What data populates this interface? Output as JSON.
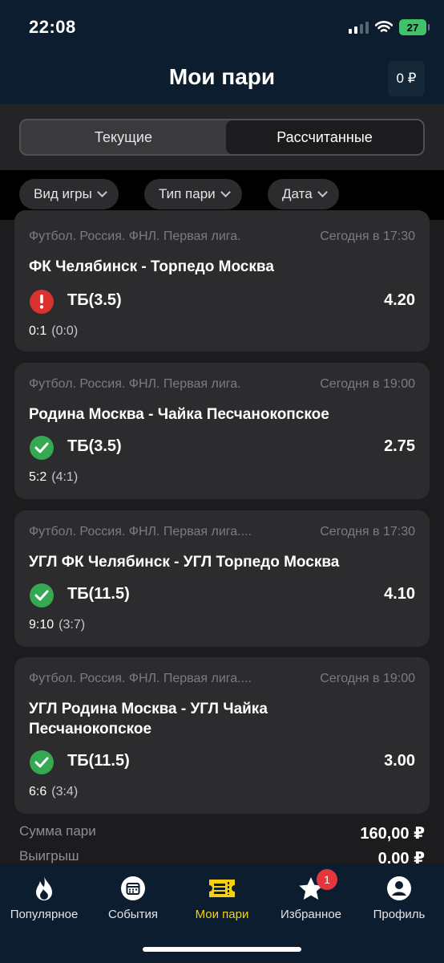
{
  "status_bar": {
    "time": "22:08",
    "battery": "27"
  },
  "header": {
    "title": "Мои пари",
    "balance": "0 ₽"
  },
  "segmented": {
    "current": "Текущие",
    "settled": "Рассчитанные"
  },
  "filters": {
    "game_type": "Вид игры",
    "bet_type": "Тип пари",
    "date": "Дата"
  },
  "bets": [
    {
      "league": "Футбол. Россия. ФНЛ. Первая лига.",
      "time": "Сегодня в 17:30",
      "match": "ФК Челябинск - Торпедо Москва",
      "status": "error",
      "bet": "ТБ(3.5)",
      "odds": "4.20",
      "score": "0:1",
      "half": "(0:0)"
    },
    {
      "league": "Футбол. Россия. ФНЛ. Первая лига.",
      "time": "Сегодня в 19:00",
      "match": "Родина Москва - Чайка Песчанокопское",
      "status": "win",
      "bet": "ТБ(3.5)",
      "odds": "2.75",
      "score": "5:2",
      "half": "(4:1)"
    },
    {
      "league": "Футбол. Россия. ФНЛ. Первая лига....",
      "time": "Сегодня в 17:30",
      "match": "УГЛ ФК Челябинск - УГЛ Торпедо Москва",
      "status": "win",
      "bet": "ТБ(11.5)",
      "odds": "4.10",
      "score": "9:10",
      "half": "(3:7)"
    },
    {
      "league": "Футбол. Россия. ФНЛ. Первая лига....",
      "time": "Сегодня в 19:00",
      "match": "УГЛ Родина Москва - УГЛ Чайка Песчанокопское",
      "status": "win",
      "bet": "ТБ(11.5)",
      "odds": "3.00",
      "score": "6:6",
      "half": "(3:4)"
    }
  ],
  "summary": {
    "stake_label": "Сумма пари",
    "stake_value": "160,00 ₽",
    "win_label": "Выигрыш",
    "win_value": "0.00 ₽"
  },
  "tabbar": {
    "popular": "Популярное",
    "events": "События",
    "my_bets": "Мои пари",
    "favorites": "Избранное",
    "favorites_badge": "1",
    "profile": "Профиль"
  },
  "colors": {
    "accent": "#f6d10d",
    "win": "#35a852",
    "error": "#d9322f",
    "header_bg": "#0b1d2e"
  },
  "icons": [
    "fire-icon",
    "calendar-icon",
    "ticket-icon",
    "star-icon",
    "person-icon",
    "check-icon",
    "exclamation-icon",
    "chevron-down-icon",
    "wifi-icon",
    "signal-icon",
    "battery-icon"
  ]
}
